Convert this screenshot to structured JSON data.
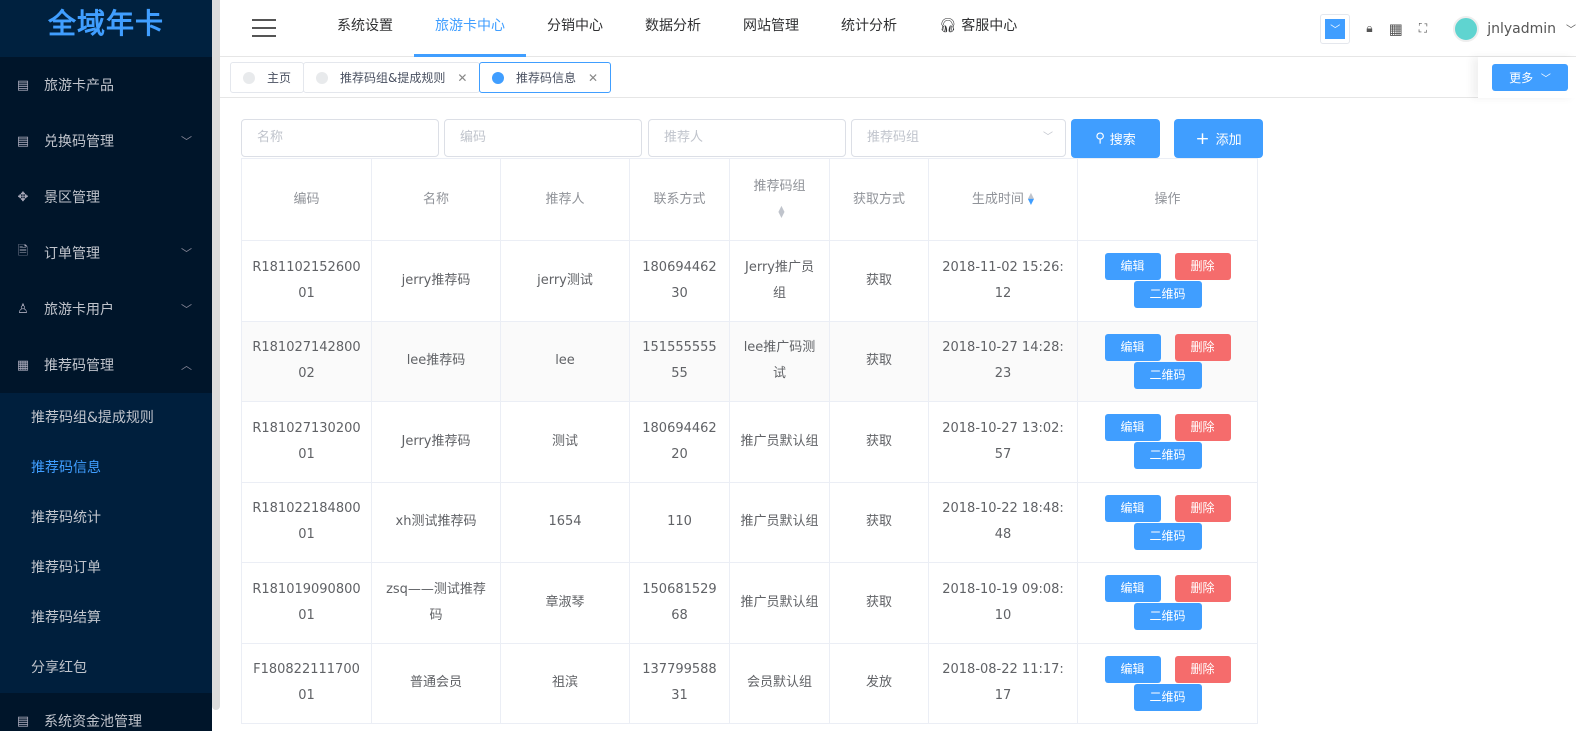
{
  "app": {
    "logo": "全域年卡"
  },
  "sidebar": {
    "items": [
      {
        "label": "旅游卡产品",
        "icon": "document-icon"
      },
      {
        "label": "兑换码管理",
        "icon": "document-icon",
        "arrow": "﹀"
      },
      {
        "label": "景区管理",
        "icon": "move-icon"
      },
      {
        "label": "订单管理",
        "icon": "file-icon",
        "arrow": "﹀"
      },
      {
        "label": "旅游卡用户",
        "icon": "user-icon",
        "arrow": "﹀"
      },
      {
        "label": "推荐码管理",
        "icon": "grid-icon",
        "arrow": "︿"
      }
    ],
    "sub": [
      "推荐码组&提成规则",
      "推荐码信息",
      "推荐码统计",
      "推荐码订单",
      "推荐码结算",
      "分享红包"
    ],
    "last": "系统资金池管理"
  },
  "topnav": {
    "items": [
      "系统设置",
      "旅游卡中心",
      "分销中心",
      "数据分析",
      "网站管理",
      "统计分析",
      "客服中心"
    ],
    "user": "jnlyadmin"
  },
  "tabs": {
    "items": [
      "主页",
      "推荐码组&提成规则",
      "推荐码信息"
    ],
    "more": "更多"
  },
  "filters": {
    "name": "名称",
    "code": "编码",
    "referrer": "推荐人",
    "group": "推荐码组",
    "search": "搜索",
    "add": "添加"
  },
  "table": {
    "headers": [
      "编码",
      "名称",
      "推荐人",
      "联系方式",
      "推荐码组",
      "获取方式",
      "生成时间",
      "操作"
    ],
    "actions": {
      "edit": "编辑",
      "delete": "删除",
      "qr": "二维码"
    },
    "rows": [
      [
        "R18110215260001",
        "jerry推荐码",
        "jerry测试",
        "18069446230",
        "Jerry推广员组",
        "获取",
        "2018-11-02 15:26:12"
      ],
      [
        "R18102714280002",
        "lee推荐码",
        "lee",
        "15155555555",
        "lee推广码测试",
        "获取",
        "2018-10-27 14:28:23"
      ],
      [
        "R18102713020001",
        "Jerry推荐码",
        "测试",
        "18069446220",
        "推广员默认组",
        "获取",
        "2018-10-27 13:02:57"
      ],
      [
        "R18102218480001",
        "xh测试推荐码",
        "1654",
        "110",
        "推广员默认组",
        "获取",
        "2018-10-22 18:48:48"
      ],
      [
        "R18101909080001",
        "zsq——测试推荐码",
        "章淑琴",
        "15068152968",
        "推广员默认组",
        "获取",
        "2018-10-19 09:08:10"
      ],
      [
        "F18082211170001",
        "普通会员",
        "祖滨",
        "13779958831",
        "会员默认组",
        "发放",
        "2018-08-22 11:17:17"
      ]
    ]
  }
}
